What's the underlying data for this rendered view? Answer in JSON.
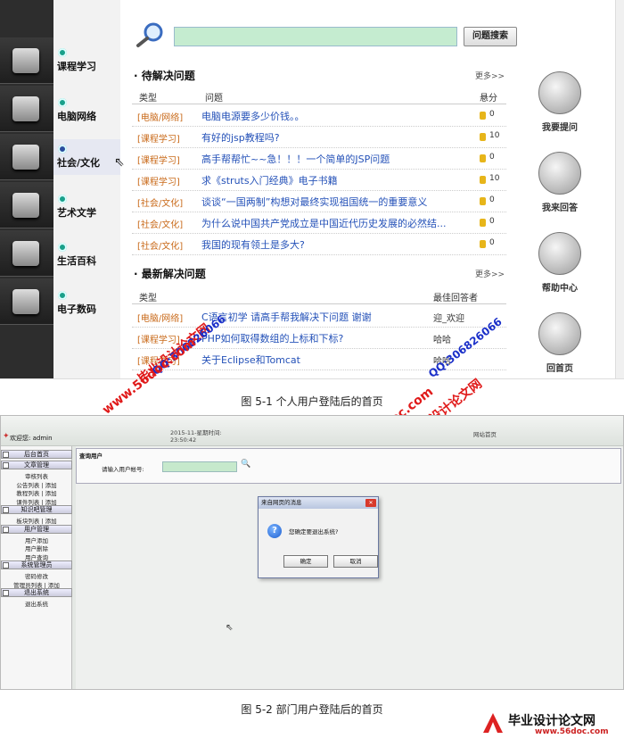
{
  "figure1": {
    "nav": [
      "课程学习",
      "电脑网络",
      "社会/文化",
      "艺术文学",
      "生活百科",
      "电子数码"
    ],
    "search_button": "问题搜索",
    "pending": {
      "title": "· 待解决问题",
      "more": "更多>>",
      "col_type": "类型",
      "col_question": "问题",
      "col_score": "悬分",
      "rows": [
        {
          "cat": "[电脑/网络]",
          "q": "电脑电源要多少价钱。。",
          "score": "0"
        },
        {
          "cat": "[课程学习]",
          "q": "有好的jsp教程吗?",
          "score": "10"
        },
        {
          "cat": "[课程学习]",
          "q": "高手帮帮忙~~急！！！一个简单的JSP问题",
          "score": "0"
        },
        {
          "cat": "[课程学习]",
          "q": "求《struts入门经典》电子书籍",
          "score": "10"
        },
        {
          "cat": "[社会/文化]",
          "q": "谈谈“一国两制”构想对最终实现祖国统一的重要意义",
          "score": "0"
        },
        {
          "cat": "[社会/文化]",
          "q": "为什么说中国共产党成立是中国近代历史发展的必然结...",
          "score": "0"
        },
        {
          "cat": "[社会/文化]",
          "q": "我国的现有领土是多大?",
          "score": "0"
        }
      ]
    },
    "solved": {
      "title": "· 最新解决问题",
      "more": "更多>>",
      "col_type": "类型",
      "col_best": "最佳回答者",
      "rows": [
        {
          "cat": "[电脑/网络]",
          "q": "C语言初学 请高手帮我解决下问题 谢谢",
          "ans": "迎_欢迎"
        },
        {
          "cat": "[课程学习]",
          "q": "PHP如何取得数组的上标和下标?",
          "ans": "哈哈"
        },
        {
          "cat": "[课程学习]",
          "q": "关于Eclipse和Tomcat",
          "ans": "哈哈"
        }
      ]
    },
    "right_buttons": [
      "我要提问",
      "我来回答",
      "帮助中心",
      "回首页"
    ]
  },
  "captions": {
    "fig1": "图 5-1   个人用户登陆后的首页",
    "fig2": "图 5-2   部门用户登陆后的首页"
  },
  "figure2": {
    "welcome": "欢迎您: admin",
    "datetime": "2015-11-星期时间:\n23:50:42",
    "site_home": "网站首页",
    "sidebar": [
      {
        "type": "head",
        "label": "后台首页"
      },
      {
        "type": "head",
        "label": "文章管理"
      },
      {
        "type": "item",
        "label": "审核列表"
      },
      {
        "type": "item",
        "label": "公告列表 | 添加"
      },
      {
        "type": "item",
        "label": "教程列表 | 添加"
      },
      {
        "type": "item",
        "label": "课件列表 | 添加"
      },
      {
        "type": "head",
        "label": "知识吧管理"
      },
      {
        "type": "item",
        "label": "板块列表 | 添加"
      },
      {
        "type": "head",
        "label": "用户管理"
      },
      {
        "type": "item",
        "label": "用户添加"
      },
      {
        "type": "item",
        "label": "用户删除"
      },
      {
        "type": "item",
        "label": "用户查询"
      },
      {
        "type": "head",
        "label": "系统管理员"
      },
      {
        "type": "item",
        "label": "密码修改"
      },
      {
        "type": "item",
        "label": "管理员列表 | 添加"
      },
      {
        "type": "head",
        "label": "退出系统"
      },
      {
        "type": "item",
        "label": "退出系统"
      }
    ],
    "panel_title": "查询用户",
    "panel_label": "请输入用户帐号:",
    "dialog": {
      "title": "来自网页的消息",
      "message": "您确定要退出系统?",
      "ok": "确定",
      "cancel": "取消"
    }
  },
  "watermarks": {
    "brand": "毕业设计论文网",
    "site": "www.56doc.com",
    "qq": "QQ:306826066"
  },
  "footer": {
    "brand": "毕业设计论文网",
    "site": "www.56doc.com"
  }
}
